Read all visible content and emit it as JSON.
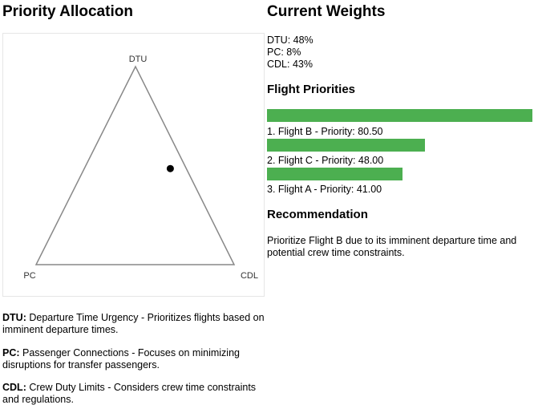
{
  "allocation": {
    "title": "Priority Allocation",
    "vertices": {
      "top": "DTU",
      "left": "PC",
      "right": "CDL"
    },
    "point_weights": {
      "DTU": 0.48,
      "PC": 0.08,
      "CDL": 0.43
    }
  },
  "descriptions": [
    {
      "key": "DTU:",
      "text": "Departure Time Urgency - Prioritizes flights based on imminent departure times."
    },
    {
      "key": "PC:",
      "text": "Passenger Connections - Focuses on minimizing disruptions for transfer passengers."
    },
    {
      "key": "CDL:",
      "text": "Crew Duty Limits - Considers crew time constraints and regulations."
    }
  ],
  "weights": {
    "title": "Current Weights",
    "items": [
      "DTU: 48%",
      "PC: 8%",
      "CDL: 43%"
    ]
  },
  "flights": {
    "title": "Flight Priorities",
    "max_priority": 80.5,
    "items": [
      {
        "label": "1. Flight B - Priority: 80.50",
        "priority": 80.5
      },
      {
        "label": "2. Flight C - Priority: 48.00",
        "priority": 48.0
      },
      {
        "label": "3. Flight A - Priority: 41.00",
        "priority": 41.0
      }
    ]
  },
  "recommendation": {
    "title": "Recommendation",
    "text": "Prioritize Flight B due to its imminent departure time and potential crew time constraints."
  },
  "colors": {
    "bar": "#4caf50",
    "triangle": "#888888",
    "point": "#000000"
  }
}
